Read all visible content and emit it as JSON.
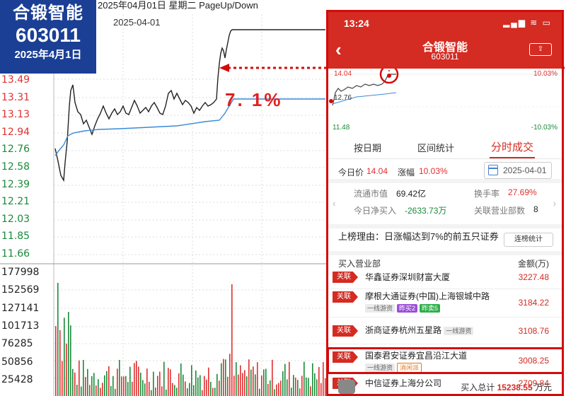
{
  "badge": {
    "name": "合锻智能",
    "code": "603011",
    "date": "2025年4月1日"
  },
  "background_chart": {
    "header_text": "2025年04月01日  星期二  PageUp/Down",
    "sub_date": "2025-04-01",
    "price_axis": [
      "13.49",
      "13.31",
      "13.13",
      "12.94",
      "12.76",
      "12.58",
      "12.39",
      "12.21",
      "12.03",
      "11.85",
      "11.66"
    ],
    "volume_axis": [
      "177998",
      "152569",
      "127141",
      "101713",
      "76285",
      "50856",
      "25428"
    ],
    "annotation": "7. 1%",
    "colors": {
      "up": "#e03030",
      "down": "#1a8a3a",
      "price_line": "#222222",
      "avg_line": "#3a8ad6"
    }
  },
  "phone": {
    "status": {
      "time": "13:24",
      "icons": "▂▄▆ ≋ ▭"
    },
    "nav": {
      "back": "‹",
      "title": "合锻智能",
      "code": "603011",
      "share": "⇪"
    },
    "mini_chart": {
      "high_price": "14.04",
      "low_price": "11.48",
      "open_price": "12.76",
      "high_pct": "10.03%",
      "low_pct": "-10.03%"
    },
    "tabs": [
      "按日期",
      "区间统计",
      "分时成交"
    ],
    "price_row": {
      "price_label": "今日价",
      "price_value": "14.04",
      "change_label": "涨幅",
      "change_value": "10.03%",
      "date": "2025-04-01"
    },
    "stats": {
      "float_cap_label": "流通市值",
      "float_cap_value": "69.42亿",
      "turnover_label": "换手率",
      "turnover_value": "27.69%",
      "net_buy_label": "今日净买入",
      "net_buy_value": "-2633.73万",
      "dept_count_label": "关联营业部数",
      "dept_count_value": "8"
    },
    "reason": {
      "text": "上榜理由：日涨幅达到7%的前五只证券",
      "button": "连榜统计"
    },
    "list_header": {
      "left": "买入营业部",
      "right": "金额(万)"
    },
    "rows": [
      {
        "tag": "关联",
        "name": "华鑫证券深圳财富大厦",
        "amount": "3227.48",
        "chips": []
      },
      {
        "tag": "关联",
        "name": "摩根大通证券(中国)上海银城中路",
        "amount": "3184.22",
        "chips": [
          "一线游资",
          "昨买2",
          "昨卖5"
        ]
      },
      {
        "tag": "关联",
        "name": "浙商证券杭州五星路",
        "amount": "3108.76",
        "chips": [
          "一线游资"
        ]
      },
      {
        "tag": "关联",
        "name": "国泰君安证券宜昌沿江大道",
        "amount": "3008.25",
        "chips": [
          "一线游资",
          "消闲派"
        ]
      },
      {
        "tag": "关联",
        "name": "中信证券上海分公司",
        "amount": "2709.84",
        "chips": []
      }
    ],
    "footer": {
      "label": "买入总计",
      "value": "15238.55",
      "unit": "万元"
    }
  }
}
